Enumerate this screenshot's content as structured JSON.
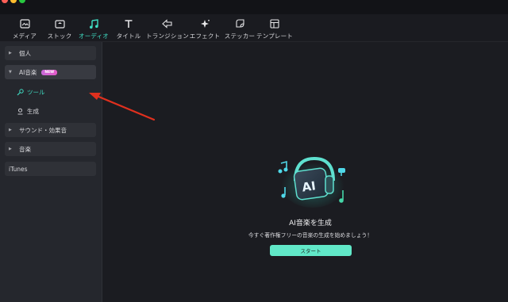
{
  "toolbar": {
    "tabs": [
      {
        "label": "メディア",
        "icon": "media-icon"
      },
      {
        "label": "ストック",
        "icon": "stock-icon"
      },
      {
        "label": "オーディオ",
        "icon": "music-note-icon",
        "active": true
      },
      {
        "label": "タイトル",
        "icon": "text-t-icon"
      },
      {
        "label": "トランジション",
        "icon": "transition-icon"
      },
      {
        "label": "エフェクト",
        "icon": "effects-sparkle-icon"
      },
      {
        "label": "ステッカー",
        "icon": "sticker-icon"
      },
      {
        "label": "テンプレート",
        "icon": "template-icon"
      }
    ]
  },
  "sidebar": {
    "items": [
      {
        "label": "個人"
      },
      {
        "label": "AI音楽",
        "badge": "NEW",
        "expanded": true,
        "children": [
          {
            "label": "ツール",
            "icon": "wand-icon",
            "active": true
          },
          {
            "label": "生成",
            "icon": "generate-icon"
          }
        ]
      },
      {
        "label": "サウンド・効果音"
      },
      {
        "label": "音楽"
      },
      {
        "label": "iTunes"
      }
    ]
  },
  "main": {
    "empty_title": "AI音楽を生成",
    "empty_subtitle": "今すぐ著作権フリーの音楽の生成を始めましょう！",
    "start_label": "スタート",
    "hero_text": "AI"
  },
  "colors": {
    "accent": "#3fdcc2",
    "button": "#61e8c8",
    "annotation_arrow": "#e0301e",
    "badge": "#d863cf"
  }
}
